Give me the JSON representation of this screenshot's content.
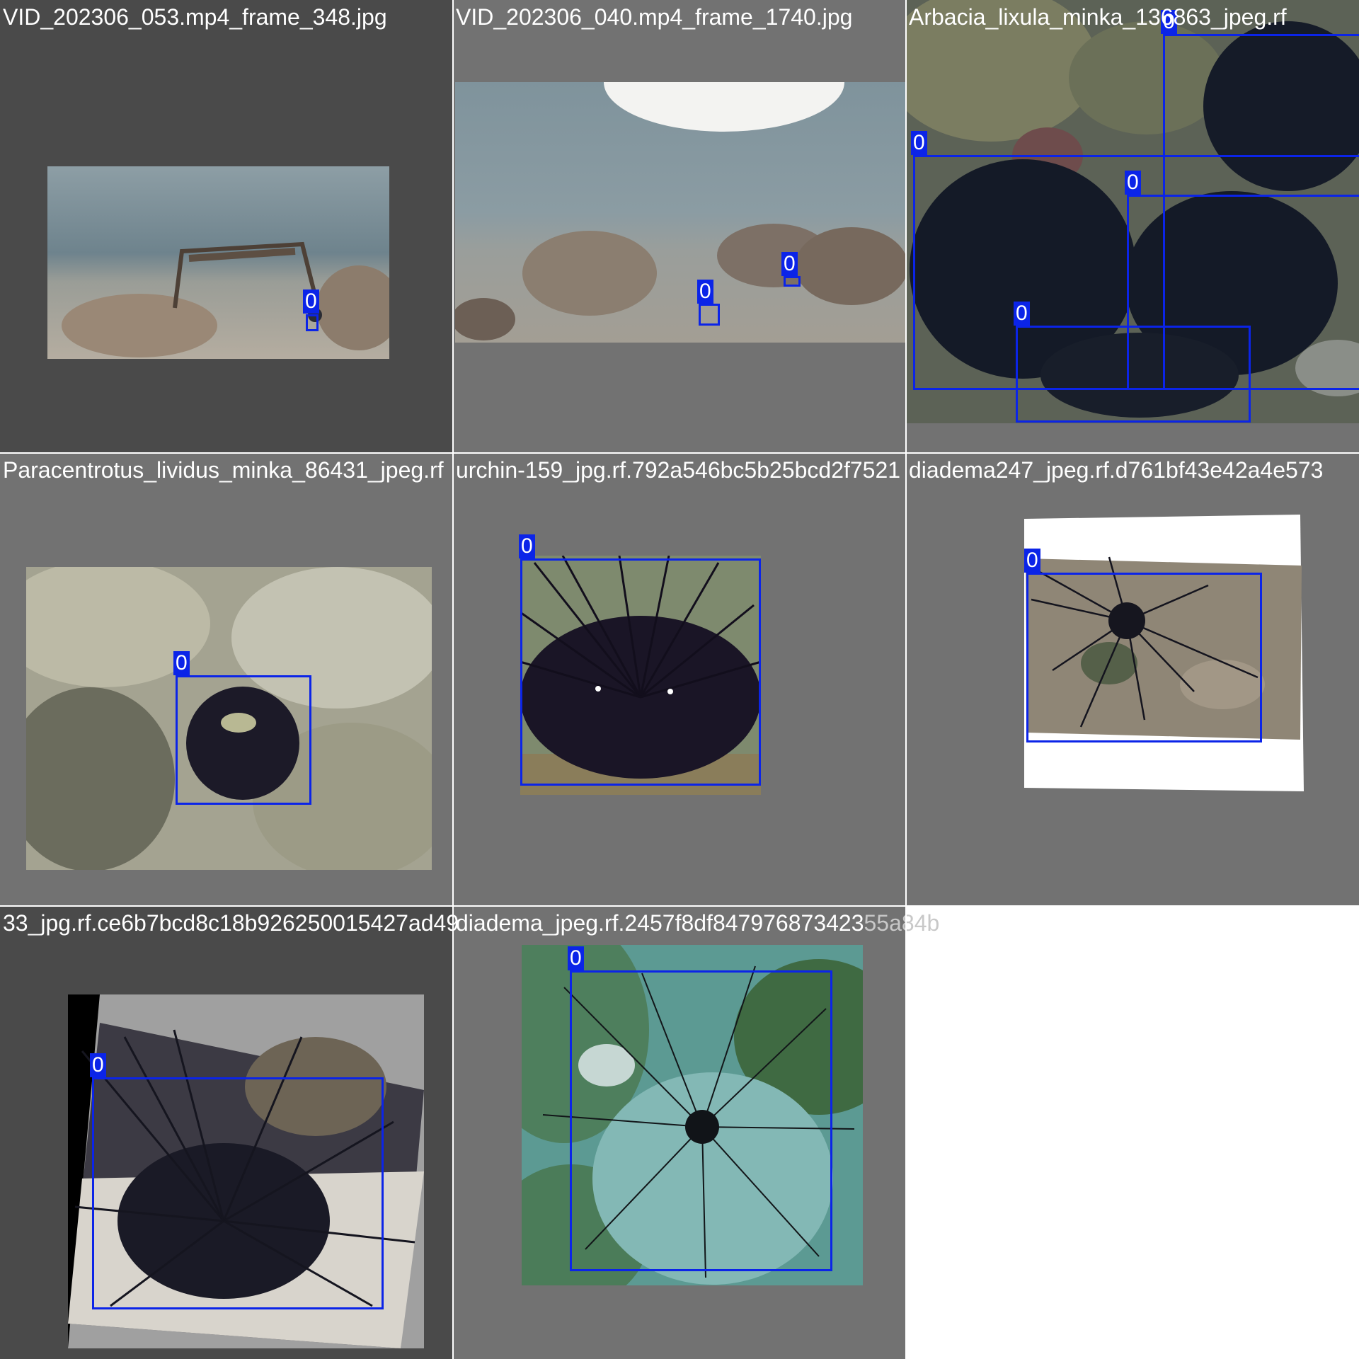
{
  "mosaic": {
    "tiles": [
      {
        "filename": "VID_202306_053.mp4_frame_348.jpg",
        "boxes": [
          {
            "label": "0"
          }
        ]
      },
      {
        "filename": "VID_202306_040.mp4_frame_1740.jpg",
        "boxes": [
          {
            "label": "0"
          },
          {
            "label": "0"
          }
        ]
      },
      {
        "filename": "Arbacia_lixula_minka_136863_jpeg.rf",
        "boxes": [
          {
            "label": "0"
          },
          {
            "label": "0"
          },
          {
            "label": "0"
          },
          {
            "label": "0"
          }
        ]
      },
      {
        "filename": "Paracentrotus_lividus_minka_86431_jpeg.rf",
        "boxes": [
          {
            "label": "0"
          }
        ]
      },
      {
        "filename": "urchin-159_jpg.rf.792a546bc5b25bcd2f7521",
        "boxes": [
          {
            "label": "0"
          }
        ]
      },
      {
        "filename": "diadema247_jpeg.rf.d761bf43e42a4e573",
        "boxes": [
          {
            "label": "0"
          }
        ]
      },
      {
        "filename": "33_jpg.rf.ce6b7bcd8c18b926250015427ad49",
        "boxes": [
          {
            "label": "0"
          }
        ]
      },
      {
        "filename": "diadema_jpeg.rf.2457f8df847976873423",
        "trailing": "55a84b",
        "boxes": [
          {
            "label": "0"
          }
        ]
      }
    ]
  },
  "colors": {
    "box": "#0b24e8",
    "label_text": "#ffffff",
    "pad_gray": "#727272",
    "pad_dark": "#4a4a4a"
  }
}
